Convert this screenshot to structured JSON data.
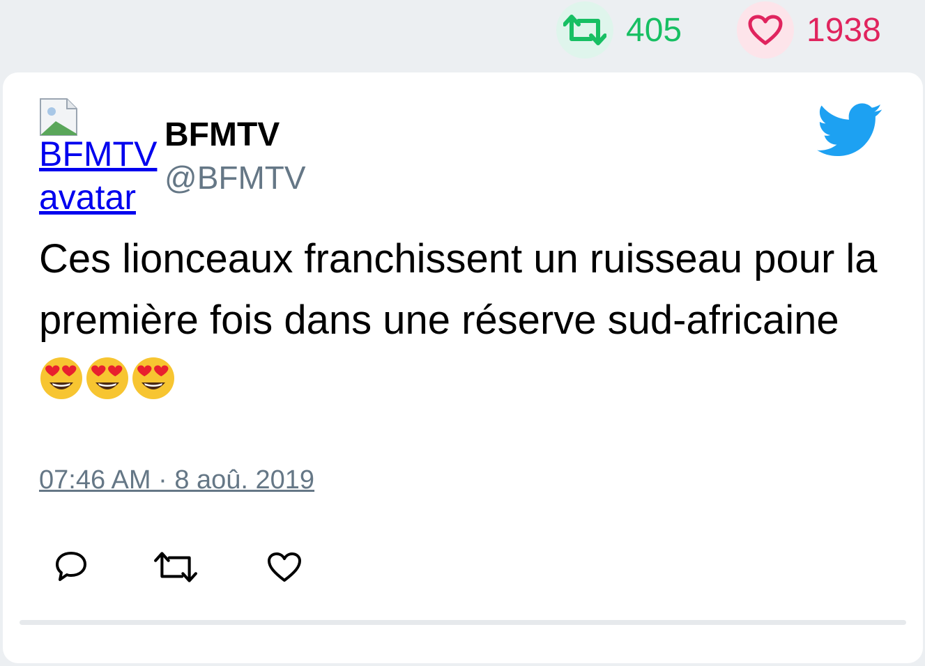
{
  "stats": {
    "retweet_count": "405",
    "like_count": "1938",
    "retweet_icon": "retweet-icon",
    "like_icon": "heart-icon"
  },
  "tweet": {
    "avatar_alt": "BFMTV avatar",
    "author_name": "BFMTV",
    "author_handle": "@BFMTV",
    "text": "Ces lionceaux franchissent un ruisseau pour la première fois dans une réserve sud-africaine",
    "emoji": "heart-eyes-emoji",
    "timestamp": "07:46 AM · 8 aoû. 2019"
  },
  "actions": [
    "reply-icon",
    "retweet-icon",
    "like-icon"
  ],
  "colors": {
    "retweet": "#17bf63",
    "like": "#e0245e",
    "twitter_blue": "#1da1f2",
    "muted": "#657786"
  }
}
